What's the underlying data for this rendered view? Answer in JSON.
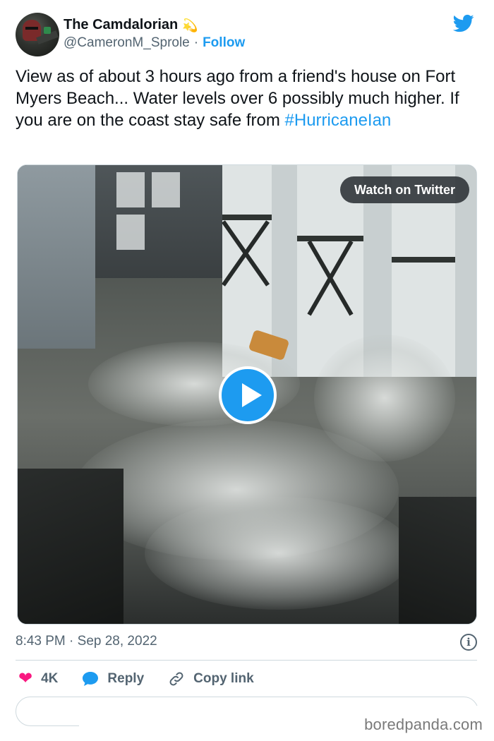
{
  "author": {
    "name": "The Camdalorian",
    "name_emoji": "💫",
    "handle": "@CameronM_Sprole",
    "separator": "·",
    "follow_label": "Follow"
  },
  "tweet": {
    "text": "View as of about 3 hours ago from a friend's house on Fort Myers Beach... Water levels over 6 possibly much higher. If you are on the coast stay safe from ",
    "hashtag": "#HurricaneIan"
  },
  "media": {
    "watch_label": "Watch on Twitter",
    "play_icon": "play-icon"
  },
  "meta": {
    "time": "8:43 PM",
    "separator": "·",
    "date": "Sep 28, 2022",
    "info_icon": "info-icon",
    "info_glyph": "i"
  },
  "actions": {
    "likes": "4K",
    "reply_label": "Reply",
    "copy_label": "Copy link"
  },
  "watermark": "boredpanda.com",
  "colors": {
    "twitter_blue": "#1d9bf0",
    "heart_pink": "#f91880",
    "muted_text": "#536471"
  }
}
